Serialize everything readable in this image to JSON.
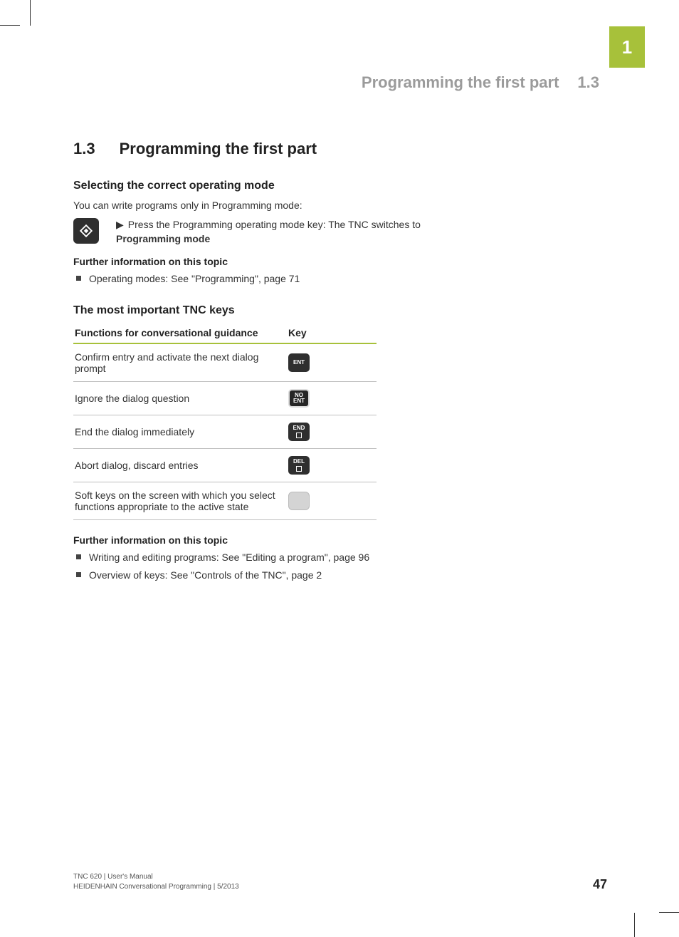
{
  "chapter_tab": "1",
  "running_head": {
    "title": "Programming the first part",
    "num": "1.3"
  },
  "heading": {
    "num": "1.3",
    "title": "Programming the first part"
  },
  "section1": {
    "title": "Selecting the correct operating mode",
    "intro": "You can write programs only in Programming mode:",
    "step_pre": "Press the Programming operating mode key: The TNC switches to ",
    "step_bold": "Programming mode",
    "further_label": "Further information on this topic",
    "further_items": [
      "Operating modes: See \"Programming\", page 71"
    ]
  },
  "section2": {
    "title": "The most important TNC keys",
    "col1": "Functions for conversational guidance",
    "col2": "Key",
    "rows": [
      {
        "text": "Confirm entry and activate the next dialog prompt",
        "key": "ENT",
        "style": "dark"
      },
      {
        "text": "Ignore the dialog question",
        "key": "NO ENT",
        "style": "outline"
      },
      {
        "text": "End the dialog immediately",
        "key": "END",
        "style": "dark-sq"
      },
      {
        "text": "Abort dialog, discard entries",
        "key": "DEL",
        "style": "dark-sq"
      },
      {
        "text": "Soft keys on the screen with which you select functions appropriate to the active state",
        "key": "",
        "style": "gray"
      }
    ],
    "further_label": "Further information on this topic",
    "further_items": [
      "Writing and editing programs: See \"Editing a program\", page 96",
      "Overview of keys: See \"Controls of the TNC\", page 2"
    ]
  },
  "footer": {
    "line1": "TNC 620 | User's Manual",
    "line2": "HEIDENHAIN Conversational Programming | 5/2013",
    "page": "47"
  }
}
